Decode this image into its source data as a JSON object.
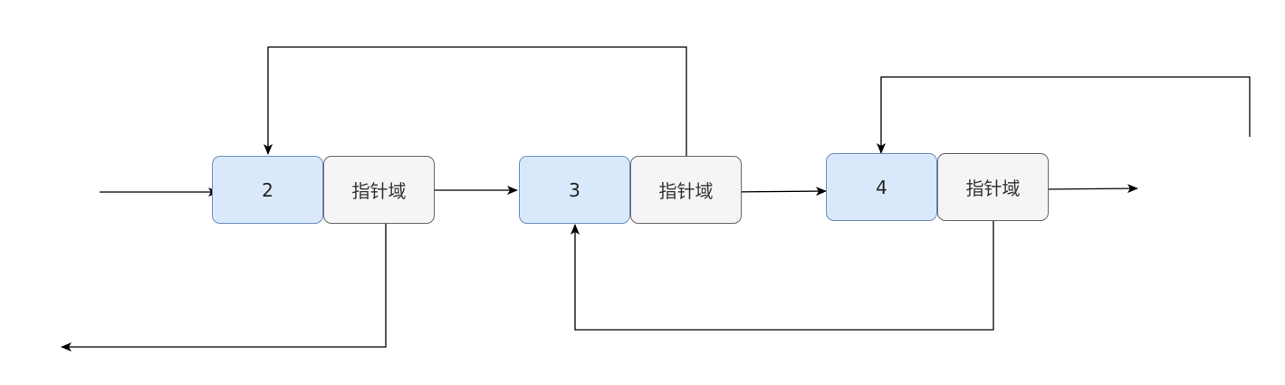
{
  "colors": {
    "data_fill": "#dae8fc",
    "data_stroke": "#6c8ebf",
    "pointer_fill": "#f5f5f5",
    "pointer_stroke": "#666666",
    "edge": "#000000"
  },
  "nodes": [
    {
      "value": "2",
      "pointer_label": "指针域"
    },
    {
      "value": "3",
      "pointer_label": "指针域"
    },
    {
      "value": "4",
      "pointer_label": "指针域"
    }
  ]
}
